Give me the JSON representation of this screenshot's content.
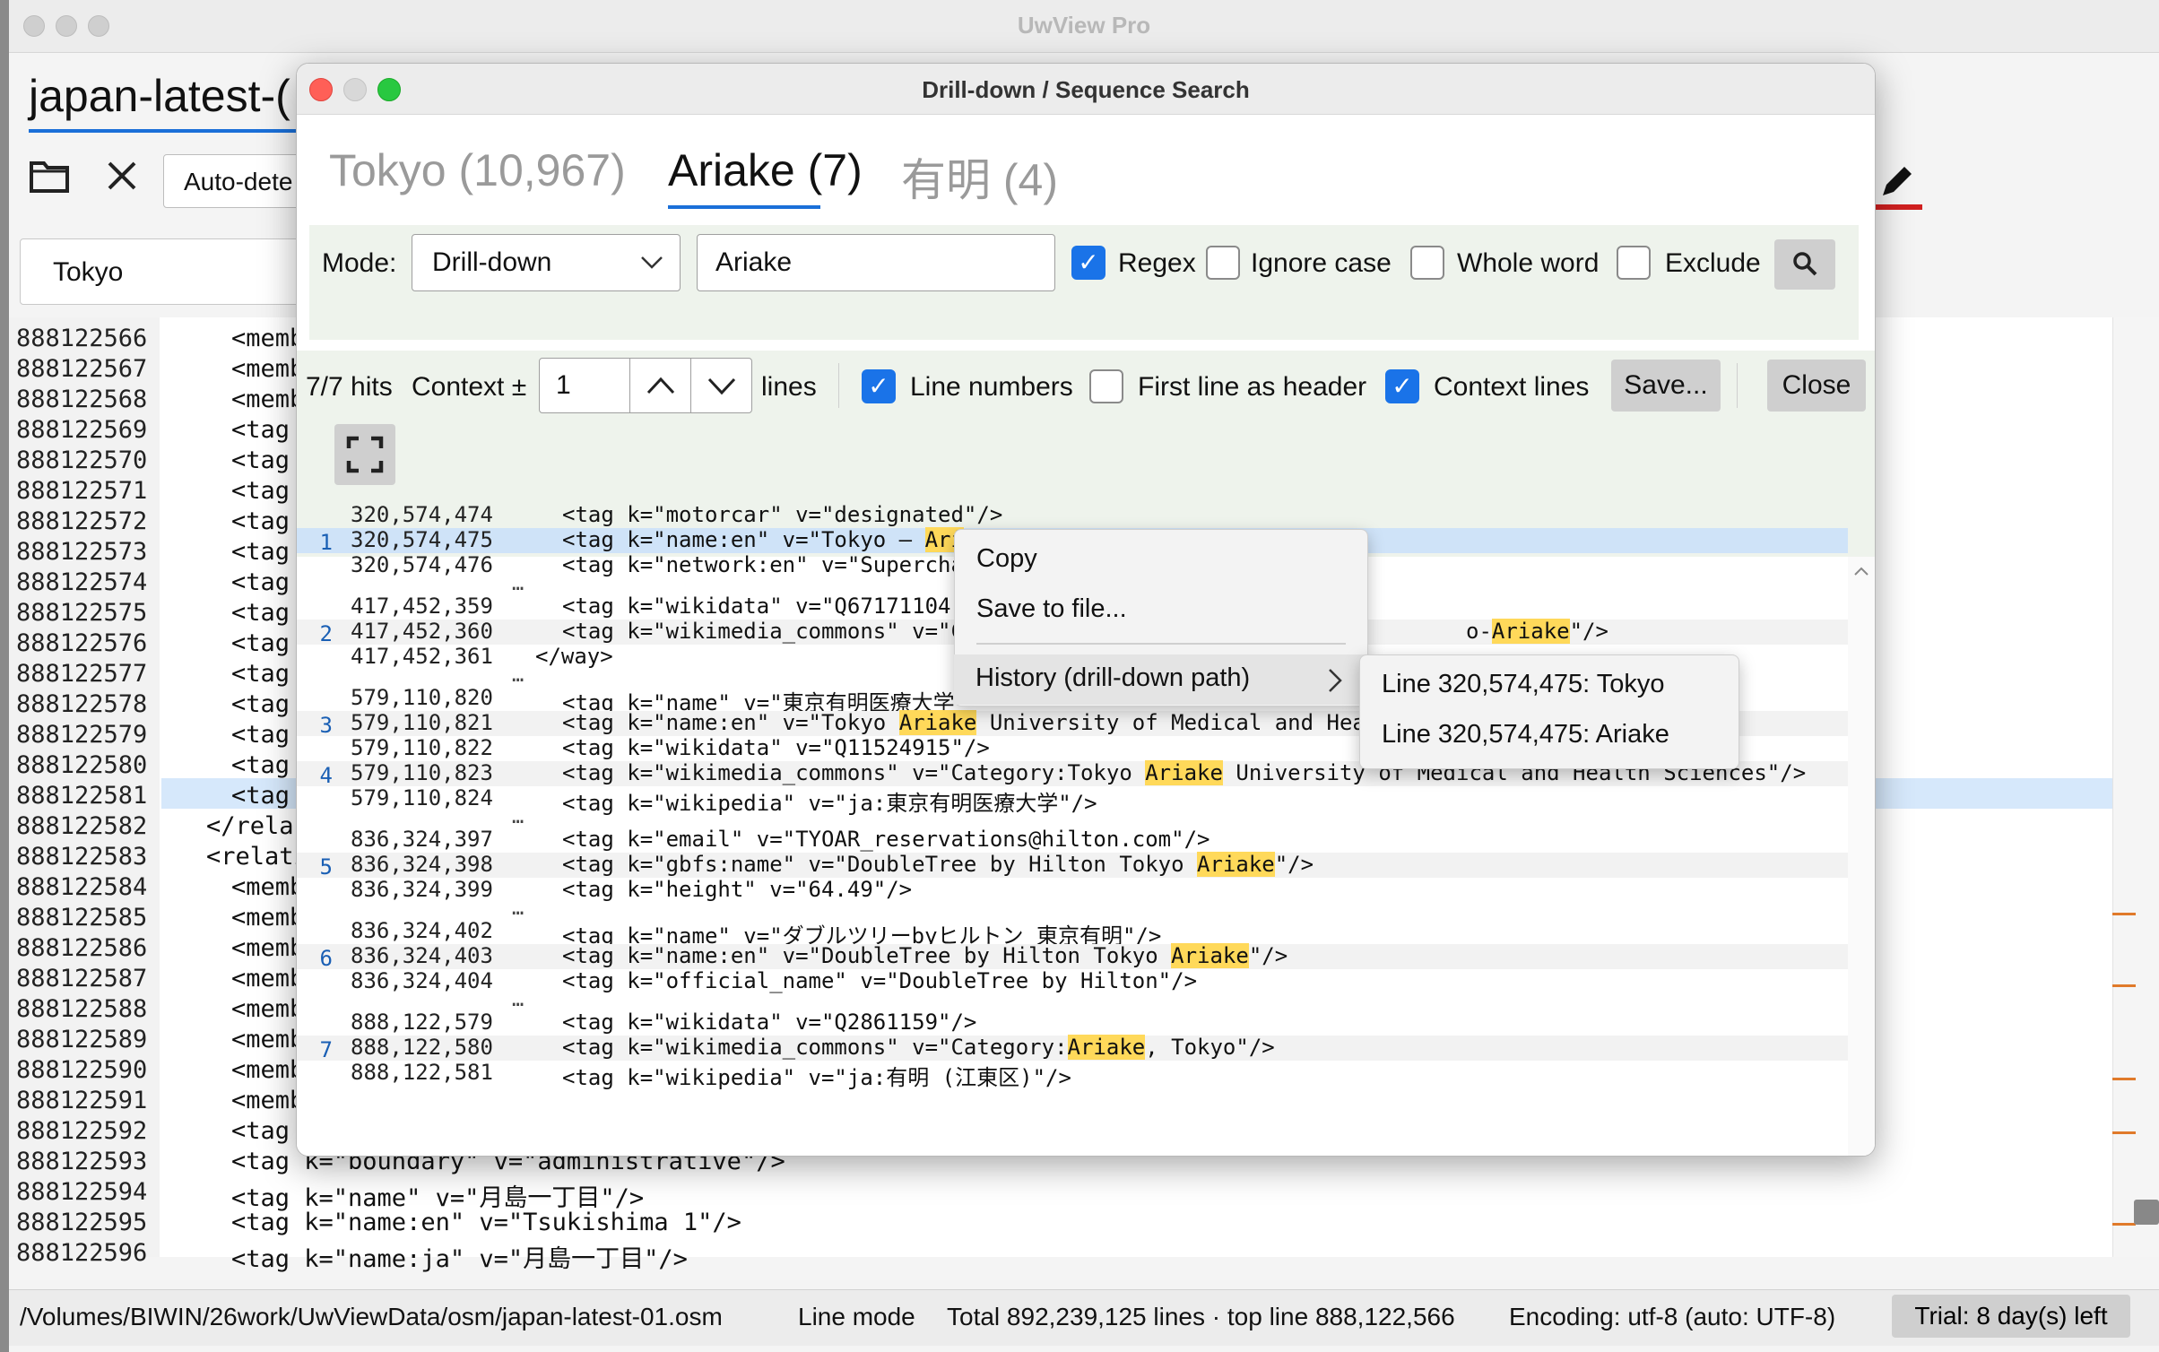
{
  "main": {
    "title": "UwView Pro",
    "doc_tab": "japan-latest-(",
    "encoding_select": "Auto-dete",
    "search_value": "Tokyo",
    "line_numbers": [
      "888122566",
      "888122567",
      "888122568",
      "888122569",
      "888122570",
      "888122571",
      "888122572",
      "888122573",
      "888122574",
      "888122575",
      "888122576",
      "888122577",
      "888122578",
      "888122579",
      "888122580",
      "888122581",
      "888122582",
      "888122583",
      "888122584",
      "888122585",
      "888122586",
      "888122587",
      "888122588",
      "888122589",
      "888122590",
      "888122591",
      "888122592",
      "888122593",
      "888122594",
      "888122595",
      "888122596"
    ],
    "line_texts": [
      "<memb",
      "<memb",
      "<memb",
      "<tag",
      "<tag",
      "<tag",
      "<tag",
      "<tag",
      "<tag",
      "<tag",
      "<tag",
      "<tag",
      "<tag",
      "<tag",
      "<tag",
      "<tag",
      "</rela",
      "<relati",
      "<memb",
      "<memb",
      "<memb",
      "<memb",
      "<memb",
      "<memb",
      "<memb",
      "<memb",
      "<tag",
      "<tag k=\"boundary\" v=\"administrative\"/>",
      "<tag k=\"name\" v=\"月島一丁目\"/>",
      "<tag k=\"name:en\" v=\"Tsukishima 1\"/>",
      "<tag k=\"name:ja\" v=\"月島一丁目\"/>"
    ]
  },
  "status": {
    "path": "/Volumes/BIWIN/26work/UwViewData/osm/japan-latest-01.osm",
    "mode": "Line mode",
    "total": "Total 892,239,125 lines · top line 888,122,566",
    "encoding": "Encoding: utf-8 (auto: UTF-8)",
    "trial": "Trial: 8 day(s) left"
  },
  "dialog": {
    "title": "Drill-down / Sequence Search",
    "tabs": [
      {
        "label": "Tokyo (10,967)"
      },
      {
        "label": "Ariake (7)"
      },
      {
        "label": "有明 (4)"
      }
    ],
    "mode_label": "Mode:",
    "mode_value": "Drill-down",
    "query": "Ariake",
    "regex_label": "Regex",
    "ignore_case_label": "Ignore case",
    "whole_word_label": "Whole word",
    "exclude_label": "Exclude",
    "hits": "7/7 hits",
    "context_label": "Context ±",
    "context_value": "1",
    "lines_label": "lines",
    "line_numbers_label": "Line numbers",
    "first_line_header_label": "First line as header",
    "context_lines_label": "Context lines",
    "save_label": "Save...",
    "close_label": "Close",
    "checkbox_states": {
      "regex": true,
      "ignore_case": false,
      "whole_word": false,
      "exclude": false,
      "line_numbers": true,
      "first_line_header": false,
      "context_lines": true
    },
    "results": [
      {
        "hit": "",
        "line": "320,574,474",
        "pre": "<tag k=\"motorcar\" v=\"designated\"/>",
        "match": "",
        "post": ""
      },
      {
        "hit": "1",
        "line": "320,574,475",
        "pre": "<tag k=\"name:en\" v=\"Tokyo – ",
        "match": "Ari",
        "post": ""
      },
      {
        "hit": "",
        "line": "320,574,476",
        "pre": "<tag k=\"network:en\" v=\"Supercha",
        "match": "",
        "post": ""
      },
      {
        "hit": "",
        "line": "417,452,359",
        "pre": "<tag k=\"wikidata\" v=\"Q67171104\"",
        "match": "",
        "post": ""
      },
      {
        "hit": "2",
        "line": "417,452,360",
        "pre": "<tag k=\"wikimedia_commons\" v=\"C",
        "match": "",
        "post": ""
      },
      {
        "hit": "",
        "line": "417,452,361",
        "pre": "</way>",
        "match": "",
        "post": ""
      },
      {
        "hit": "",
        "line": "579,110,820",
        "pre": "<tag k=\"name\" v=\"東京有明医療大学\"",
        "match": "",
        "post": ""
      },
      {
        "hit": "3",
        "line": "579,110,821",
        "pre": "<tag k=\"name:en\" v=\"Tokyo ",
        "match": "Ariake",
        "post": " University of Medical and Hea"
      },
      {
        "hit": "",
        "line": "579,110,822",
        "pre": "<tag k=\"wikidata\" v=\"Q11524915\"/>",
        "match": "",
        "post": ""
      },
      {
        "hit": "4",
        "line": "579,110,823",
        "pre": "<tag k=\"wikimedia_commons\" v=\"Category:Tokyo ",
        "match": "Ariake",
        "post": " University of Medical and Health Sciences\"/>"
      },
      {
        "hit": "",
        "line": "579,110,824",
        "pre": "<tag k=\"wikipedia\" v=\"ja:東京有明医療大学\"/>",
        "match": "",
        "post": ""
      },
      {
        "hit": "",
        "line": "836,324,397",
        "pre": "<tag k=\"email\" v=\"TYOAR_reservations@hilton.com\"/>",
        "match": "",
        "post": ""
      },
      {
        "hit": "5",
        "line": "836,324,398",
        "pre": "<tag k=\"gbfs:name\" v=\"DoubleTree by Hilton Tokyo ",
        "match": "Ariake",
        "post": "\"/>"
      },
      {
        "hit": "",
        "line": "836,324,399",
        "pre": "<tag k=\"height\" v=\"64.49\"/>",
        "match": "",
        "post": ""
      },
      {
        "hit": "",
        "line": "836,324,402",
        "pre": "<tag k=\"name\" v=\"ダブルツリーbyヒルトン 東京有明\"/>",
        "match": "",
        "post": ""
      },
      {
        "hit": "6",
        "line": "836,324,403",
        "pre": "<tag k=\"name:en\" v=\"DoubleTree by Hilton Tokyo ",
        "match": "Ariake",
        "post": "\"/>"
      },
      {
        "hit": "",
        "line": "836,324,404",
        "pre": "<tag k=\"official_name\" v=\"DoubleTree by Hilton\"/>",
        "match": "",
        "post": ""
      },
      {
        "hit": "",
        "line": "888,122,579",
        "pre": "<tag k=\"wikidata\" v=\"Q2861159\"/>",
        "match": "",
        "post": ""
      },
      {
        "hit": "7",
        "line": "888,122,580",
        "pre": "<tag k=\"wikimedia_commons\" v=\"Category:",
        "match": "Ariake",
        "post": ", Tokyo\"/>"
      },
      {
        "hit": "",
        "line": "888,122,581",
        "pre": "<tag k=\"wikipedia\" v=\"ja:有明 (江東区)\"/>",
        "match": "",
        "post": ""
      }
    ],
    "row2_tail_pre": "o-",
    "row2_tail_match": "Ariake",
    "row2_tail_post": "\"/>",
    "ellipsis": "…"
  },
  "context_menu": {
    "copy": "Copy",
    "save_to_file": "Save to file...",
    "history": "History (drill-down path)",
    "history_items": [
      "Line 320,574,475: Tokyo",
      "Line 320,574,475: Ariake"
    ]
  }
}
